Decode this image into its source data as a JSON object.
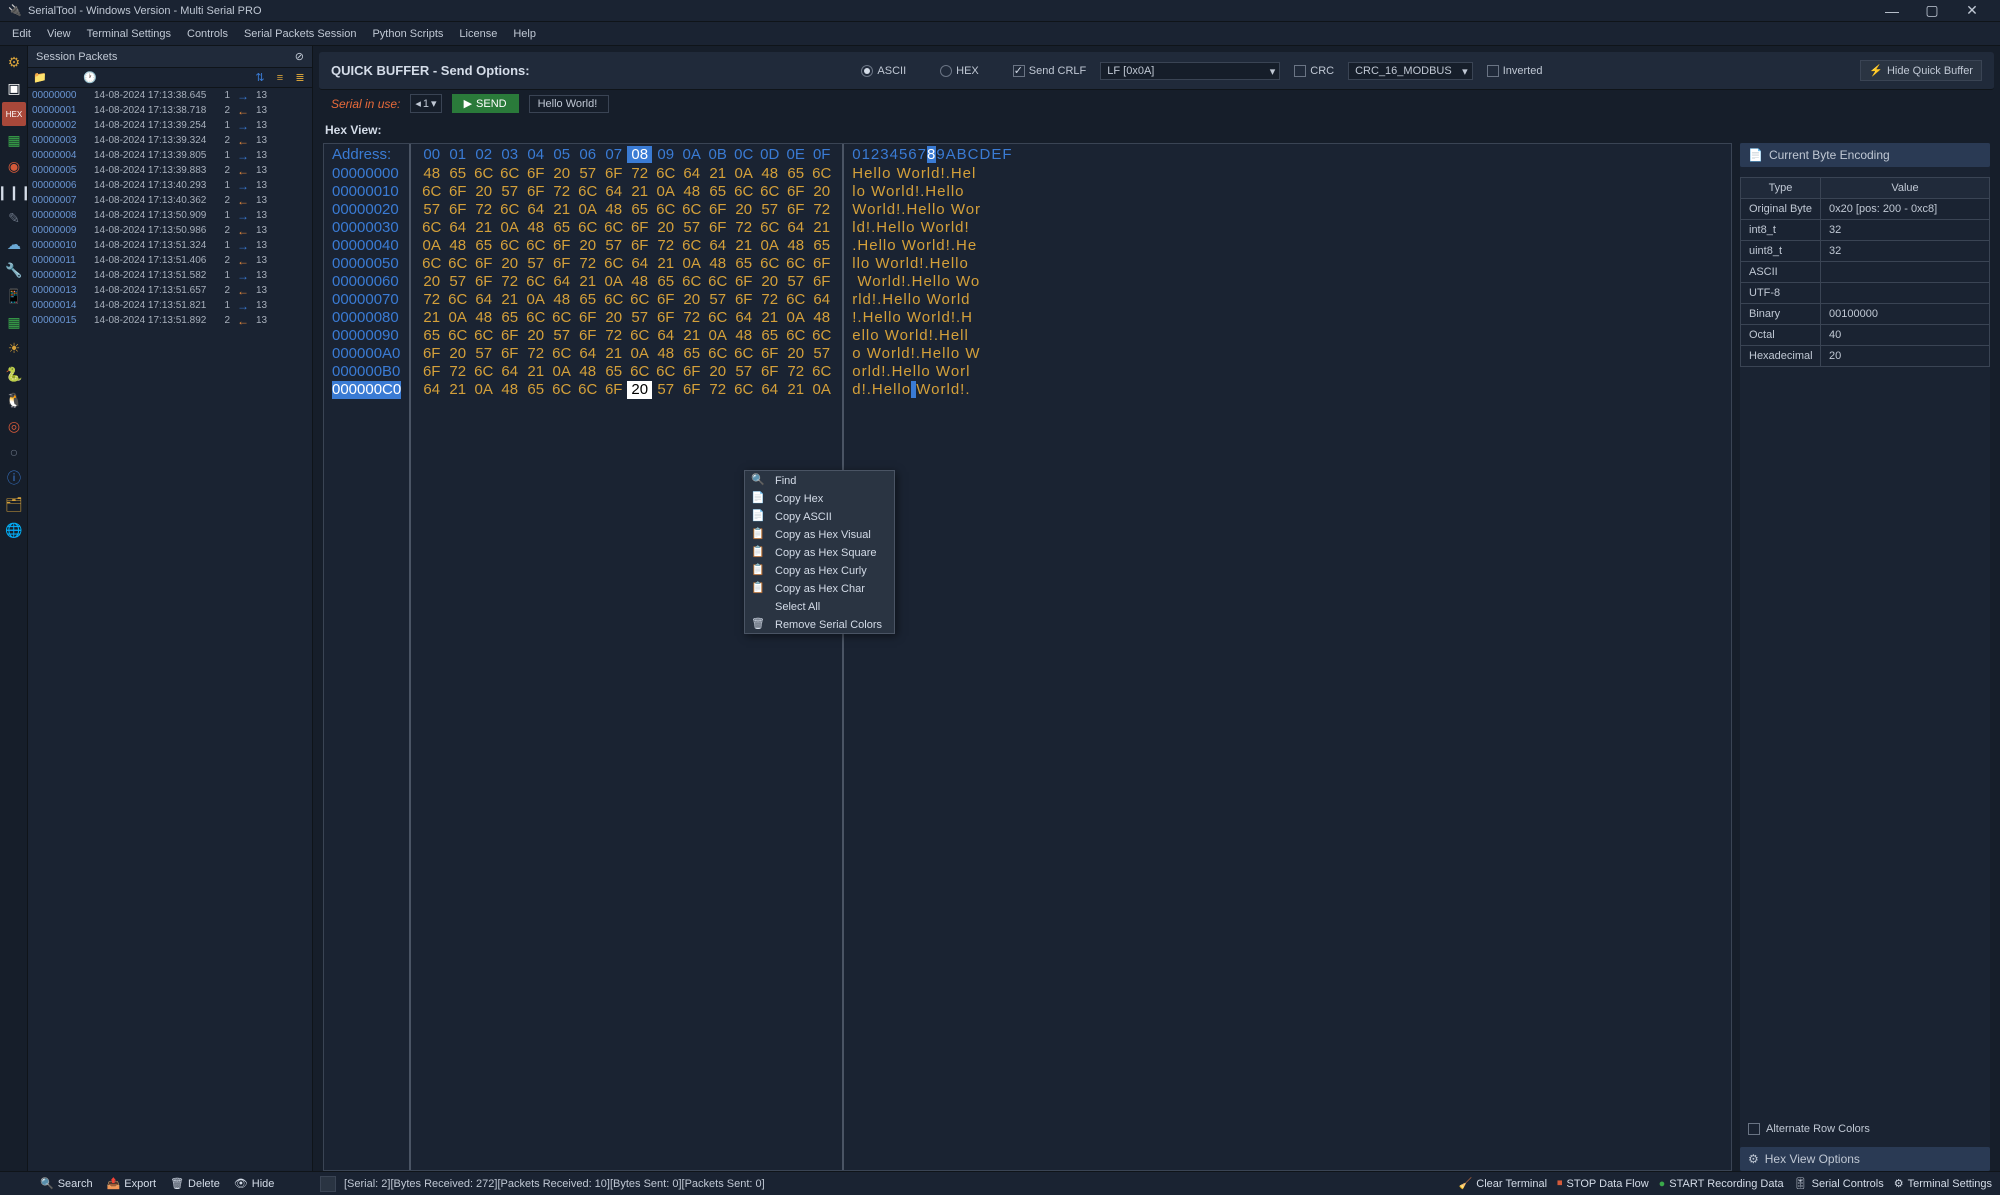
{
  "titlebar": {
    "text": "SerialTool - Windows Version  - Multi Serial PRO"
  },
  "menubar": [
    "Edit",
    "View",
    "Terminal Settings",
    "Controls",
    "Serial Packets Session",
    "Python Scripts",
    "License",
    "Help"
  ],
  "session_panel": {
    "title": "Session Packets",
    "packets": [
      {
        "id": "00000000",
        "time": "14-08-2024 17:13:38.645",
        "n": "1",
        "dir": "r",
        "size": "13"
      },
      {
        "id": "00000001",
        "time": "14-08-2024 17:13:38.718",
        "n": "2",
        "dir": "l",
        "size": "13"
      },
      {
        "id": "00000002",
        "time": "14-08-2024 17:13:39.254",
        "n": "1",
        "dir": "r",
        "size": "13"
      },
      {
        "id": "00000003",
        "time": "14-08-2024 17:13:39.324",
        "n": "2",
        "dir": "l",
        "size": "13"
      },
      {
        "id": "00000004",
        "time": "14-08-2024 17:13:39.805",
        "n": "1",
        "dir": "r",
        "size": "13"
      },
      {
        "id": "00000005",
        "time": "14-08-2024 17:13:39.883",
        "n": "2",
        "dir": "l",
        "size": "13"
      },
      {
        "id": "00000006",
        "time": "14-08-2024 17:13:40.293",
        "n": "1",
        "dir": "r",
        "size": "13"
      },
      {
        "id": "00000007",
        "time": "14-08-2024 17:13:40.362",
        "n": "2",
        "dir": "l",
        "size": "13"
      },
      {
        "id": "00000008",
        "time": "14-08-2024 17:13:50.909",
        "n": "1",
        "dir": "r",
        "size": "13"
      },
      {
        "id": "00000009",
        "time": "14-08-2024 17:13:50.986",
        "n": "2",
        "dir": "l",
        "size": "13"
      },
      {
        "id": "00000010",
        "time": "14-08-2024 17:13:51.324",
        "n": "1",
        "dir": "r",
        "size": "13"
      },
      {
        "id": "00000011",
        "time": "14-08-2024 17:13:51.406",
        "n": "2",
        "dir": "l",
        "size": "13"
      },
      {
        "id": "00000012",
        "time": "14-08-2024 17:13:51.582",
        "n": "1",
        "dir": "r",
        "size": "13"
      },
      {
        "id": "00000013",
        "time": "14-08-2024 17:13:51.657",
        "n": "2",
        "dir": "l",
        "size": "13"
      },
      {
        "id": "00000014",
        "time": "14-08-2024 17:13:51.821",
        "n": "1",
        "dir": "r",
        "size": "13"
      },
      {
        "id": "00000015",
        "time": "14-08-2024 17:13:51.892",
        "n": "2",
        "dir": "l",
        "size": "13"
      }
    ]
  },
  "quick_buffer": {
    "label": "QUICK BUFFER - Send Options:",
    "ascii": "ASCII",
    "hex": "HEX",
    "send_crlf": "Send CRLF",
    "crlf_select": "LF [0x0A]",
    "crc": "CRC",
    "crc_select": "CRC_16_MODBUS",
    "inverted": "Inverted",
    "hide_btn": "Hide Quick Buffer"
  },
  "serial_bar": {
    "label": "Serial in use:",
    "spin_value": "1",
    "send": "SEND",
    "text_value": "Hello World!"
  },
  "hex_view": {
    "label": "Hex View:",
    "addr_header": "Address:",
    "headers": [
      "00",
      "01",
      "02",
      "03",
      "04",
      "05",
      "06",
      "07",
      "08",
      "09",
      "0A",
      "0B",
      "0C",
      "0D",
      "0E",
      "0F"
    ],
    "ascii_header_pre": "01234567",
    "ascii_header_sel": "8",
    "ascii_header_post": "9ABCDEF",
    "addrs": [
      "00000000",
      "00000010",
      "00000020",
      "00000030",
      "00000040",
      "00000050",
      "00000060",
      "00000070",
      "00000080",
      "00000090",
      "000000A0",
      "000000B0",
      "000000C0"
    ],
    "rows": [
      [
        "48",
        "65",
        "6C",
        "6C",
        "6F",
        "20",
        "57",
        "6F",
        "72",
        "6C",
        "64",
        "21",
        "0A",
        "48",
        "65",
        "6C"
      ],
      [
        "6C",
        "6F",
        "20",
        "57",
        "6F",
        "72",
        "6C",
        "64",
        "21",
        "0A",
        "48",
        "65",
        "6C",
        "6C",
        "6F",
        "20"
      ],
      [
        "57",
        "6F",
        "72",
        "6C",
        "64",
        "21",
        "0A",
        "48",
        "65",
        "6C",
        "6C",
        "6F",
        "20",
        "57",
        "6F",
        "72"
      ],
      [
        "6C",
        "64",
        "21",
        "0A",
        "48",
        "65",
        "6C",
        "6C",
        "6F",
        "20",
        "57",
        "6F",
        "72",
        "6C",
        "64",
        "21"
      ],
      [
        "0A",
        "48",
        "65",
        "6C",
        "6C",
        "6F",
        "20",
        "57",
        "6F",
        "72",
        "6C",
        "64",
        "21",
        "0A",
        "48",
        "65"
      ],
      [
        "6C",
        "6C",
        "6F",
        "20",
        "57",
        "6F",
        "72",
        "6C",
        "64",
        "21",
        "0A",
        "48",
        "65",
        "6C",
        "6C",
        "6F"
      ],
      [
        "20",
        "57",
        "6F",
        "72",
        "6C",
        "64",
        "21",
        "0A",
        "48",
        "65",
        "6C",
        "6C",
        "6F",
        "20",
        "57",
        "6F"
      ],
      [
        "72",
        "6C",
        "64",
        "21",
        "0A",
        "48",
        "65",
        "6C",
        "6C",
        "6F",
        "20",
        "57",
        "6F",
        "72",
        "6C",
        "64"
      ],
      [
        "21",
        "0A",
        "48",
        "65",
        "6C",
        "6C",
        "6F",
        "20",
        "57",
        "6F",
        "72",
        "6C",
        "64",
        "21",
        "0A",
        "48"
      ],
      [
        "65",
        "6C",
        "6C",
        "6F",
        "20",
        "57",
        "6F",
        "72",
        "6C",
        "64",
        "21",
        "0A",
        "48",
        "65",
        "6C",
        "6C"
      ],
      [
        "6F",
        "20",
        "57",
        "6F",
        "72",
        "6C",
        "64",
        "21",
        "0A",
        "48",
        "65",
        "6C",
        "6C",
        "6F",
        "20",
        "57"
      ],
      [
        "6F",
        "72",
        "6C",
        "64",
        "21",
        "0A",
        "48",
        "65",
        "6C",
        "6C",
        "6F",
        "20",
        "57",
        "6F",
        "72",
        "6C"
      ],
      [
        "64",
        "21",
        "0A",
        "48",
        "65",
        "6C",
        "6C",
        "6F",
        "20",
        "57",
        "6F",
        "72",
        "6C",
        "64",
        "21",
        "0A"
      ]
    ],
    "ascii_rows": [
      "Hello World!.Hel",
      "lo World!.Hello ",
      "World!.Hello Wor",
      "ld!.Hello World!",
      ".Hello World!.He",
      "llo World!.Hello",
      " World!.Hello Wo",
      "rld!.Hello World",
      "!.Hello World!.H",
      "ello World!.Hell",
      "o World!.Hello W",
      "orld!.Hello Worl",
      "d!.Hello World!."
    ]
  },
  "encoding": {
    "title": "Current Byte Encoding",
    "head_type": "Type",
    "head_value": "Value",
    "rows": [
      {
        "type": "Original Byte",
        "value": "0x20  [pos: 200 - 0xc8]"
      },
      {
        "type": "int8_t",
        "value": "32"
      },
      {
        "type": "uint8_t",
        "value": "32"
      },
      {
        "type": "ASCII",
        "value": ""
      },
      {
        "type": "UTF-8",
        "value": ""
      },
      {
        "type": "Binary",
        "value": "00100000"
      },
      {
        "type": "Octal",
        "value": "40"
      },
      {
        "type": "Hexadecimal",
        "value": "20"
      }
    ],
    "alternate": "Alternate Row Colors",
    "options": "Hex View Options"
  },
  "context_menu": {
    "items": [
      "Find",
      "Copy Hex",
      "Copy ASCII",
      "Copy as Hex Visual",
      "Copy as Hex Square",
      "Copy as Hex Curly",
      "Copy as Hex Char",
      "Select All",
      "Remove Serial Colors"
    ]
  },
  "statusbar": {
    "search": "Search",
    "export": "Export",
    "delete": "Delete",
    "hide": "Hide",
    "center": "[Serial: 2][Bytes Received: 272][Packets Received: 10][Bytes Sent: 0][Packets Sent: 0]",
    "clear": "Clear Terminal",
    "stop_flow": "STOP Data Flow",
    "start_rec": "START Recording Data",
    "serial_controls": "Serial Controls",
    "terminal_settings": "Terminal Settings"
  }
}
